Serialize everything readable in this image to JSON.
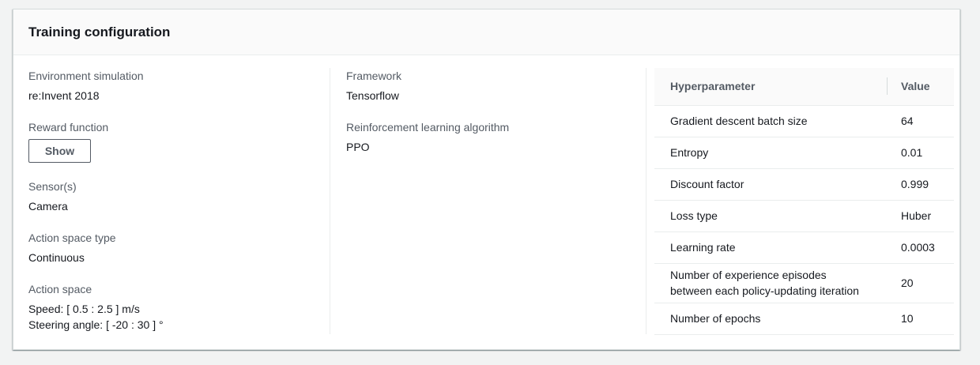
{
  "panel": {
    "title": "Training configuration"
  },
  "left": {
    "environment": {
      "label": "Environment simulation",
      "value": "re:Invent 2018"
    },
    "reward": {
      "label": "Reward function",
      "button": "Show"
    },
    "sensors": {
      "label": "Sensor(s)",
      "value": "Camera"
    },
    "action_space_type": {
      "label": "Action space type",
      "value": "Continuous"
    },
    "action_space": {
      "label": "Action space",
      "speed": "Speed: [ 0.5 : 2.5 ] m/s",
      "steering": "Steering angle: [ -20 : 30 ] °"
    }
  },
  "middle": {
    "framework": {
      "label": "Framework",
      "value": "Tensorflow"
    },
    "algorithm": {
      "label": "Reinforcement learning algorithm",
      "value": "PPO"
    }
  },
  "hyperparameters": {
    "columns": [
      "Hyperparameter",
      "Value"
    ],
    "rows": [
      {
        "name": "Gradient descent batch size",
        "value": "64"
      },
      {
        "name": "Entropy",
        "value": "0.01"
      },
      {
        "name": "Discount factor",
        "value": "0.999"
      },
      {
        "name": "Loss type",
        "value": "Huber"
      },
      {
        "name": "Learning rate",
        "value": "0.0003"
      },
      {
        "name": "Number of experience episodes",
        "name2": "between each policy-updating iteration",
        "value": "20"
      },
      {
        "name": "Number of epochs",
        "value": "10"
      }
    ]
  }
}
